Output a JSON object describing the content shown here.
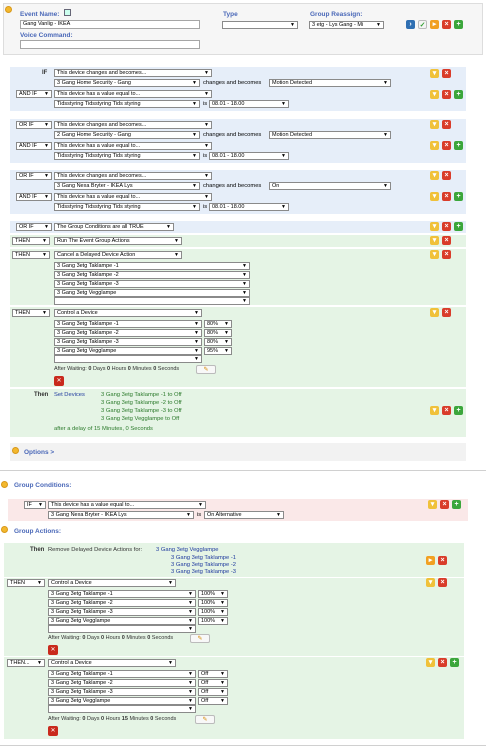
{
  "event": {
    "name_label": "Event Name:",
    "name_value": "Gang Vanlig - IKEA",
    "voice_label": "Voice Command:",
    "voice_value": "",
    "type_label": "Type",
    "type_value": "",
    "reassign_label": "Group Reassign:",
    "reassign_value": "3 etg - Lys Gang - Mi"
  },
  "conditions": {
    "b1": {
      "if_kw": "IF",
      "c1": "This device changes and becomes...",
      "c1_dev": "3 Gang Home Security - Gang",
      "c1_mid": "changes and becomes",
      "c1_state": "Motion Detected",
      "and_kw": "AND IF",
      "c2": "This device has a value equal to...",
      "c2_dev": "Tidsstyring Tidsstyring Tids styring",
      "is": "is",
      "c2_val": "08.01 - 18.00"
    },
    "b2": {
      "or_kw": "OR IF",
      "c1": "This device changes and becomes...",
      "c1_dev": "2 Gang Home Security - Gang",
      "c1_mid": "changes and becomes",
      "c1_state": "Motion Detected",
      "and_kw": "AND IF",
      "c2": "This device has a value equal to...",
      "c2_dev": "Tidsstyring Tidsstyring Tids styring",
      "is": "is",
      "c2_val": "08.01 - 18.00"
    },
    "b3": {
      "or_kw": "OR IF",
      "c1": "This device changes and becomes...",
      "c1_dev": "3 Gang Nexa Bryter - IKEA Lys",
      "c1_mid": "changes and becomes",
      "c1_state": "On",
      "and_kw": "AND IF",
      "c2": "This device has a value equal to...",
      "c2_dev": "Tidsstyring Tidsstyring Tids styring",
      "is": "is",
      "c2_val": "08.01 - 18.00"
    },
    "b4": {
      "or_kw": "OR IF",
      "c1": "The Group Conditions are all TRUE"
    }
  },
  "actions": {
    "a1": {
      "kw": "THEN",
      "value": "Run The Event Group Actions"
    },
    "a2": {
      "kw": "THEN",
      "value": "Cancel a Delayed Device Action",
      "devices": [
        "3 Gang 3etg Taklampe -1",
        "3 Gang 3etg Taklampe -2",
        "3 Gang 3etg Taklampe -3",
        "3 Gang 3etg Vegglampe",
        ""
      ]
    },
    "a3": {
      "kw": "THEN",
      "value": "Control a Device",
      "devices": [
        "3 Gang 3etg Taklampe -1",
        "3 Gang 3etg Taklampe -2",
        "3 Gang 3etg Taklampe -3",
        "3 Gang 3etg Vegglampe",
        ""
      ],
      "levels": [
        "80%",
        "80%",
        "80%",
        "95%"
      ],
      "wait_prefix": "After Waiting:",
      "days": "0",
      "days_label": "Days",
      "hours": "0",
      "hours_label": "Hours",
      "minutes": "0",
      "minutes_label": "Minutes",
      "seconds": "0",
      "seconds_label": "Seconds"
    },
    "summary": {
      "then": "Then",
      "set": "Set Devices",
      "lines": [
        "3 Gang 3etg Taklampe -1 to Off",
        "3 Gang 3etg Taklampe -2 to Off",
        "3 Gang 3etg Taklampe -3 to Off",
        "3 Gang 3etg Vegglampe to Off"
      ],
      "delay": "after a delay of 15 Minutes, 0 Seconds"
    }
  },
  "options_label": "Options >",
  "group_conditions": {
    "title": "Group Conditions:",
    "kw": "IF",
    "c1": "This device has a value equal to...",
    "dev": "3 Gang Nexa Bryter - IKEA Lys",
    "is": "is",
    "val": "On Alternative"
  },
  "group_actions": {
    "title": "Group Actions:",
    "then": "Then",
    "remove_text": "Remove Delayed Device Actions for:",
    "remove_list": [
      "3 Gang 3etg Vegglampe",
      "3 Gang 3etg Taklampe -1",
      "3 Gang 3etg Taklampe -2",
      "3 Gang 3etg Taklampe -3"
    ],
    "g1": {
      "kw": "THEN",
      "value": "Control a Device",
      "devices": [
        "3 Gang 3etg Taklampe -1",
        "3 Gang 3etg Taklampe -2",
        "3 Gang 3etg Taklampe -3",
        "3 Gang 3etg Vegglampe",
        ""
      ],
      "levels": [
        "100%",
        "100%",
        "100%",
        "100%"
      ],
      "wait_prefix": "After Waiting:",
      "days": "0",
      "days_label": "Days",
      "hours": "0",
      "hours_label": "Hours",
      "minutes": "0",
      "minutes_label": "Minutes",
      "seconds": "0",
      "seconds_label": "Seconds"
    },
    "g2": {
      "kw": "THEN...",
      "value": "Control a Device",
      "devices": [
        "3 Gang 3etg Taklampe -1",
        "3 Gang 3etg Taklampe -2",
        "3 Gang 3etg Taklampe -3",
        "3 Gang 3etg Vegglampe",
        ""
      ],
      "levels": [
        "Off",
        "Off",
        "Off",
        "Off"
      ],
      "wait_prefix": "After Waiting:",
      "days": "0",
      "days_label": "Days",
      "hours": "0",
      "hours_label": "Hours",
      "minutes": "15",
      "minutes_label": "Minutes",
      "seconds": "0",
      "seconds_label": "Seconds"
    }
  },
  "icons": {
    "dropdown": "chevron-down-icon",
    "up": "arrow-up-icon",
    "delete": "x-icon",
    "add": "plus-icon",
    "play": "play-icon",
    "go": "go-icon",
    "check": "check-icon",
    "edit": "pencil-icon",
    "calendar": "calendar-icon",
    "expand": "expand-circle-icon"
  },
  "colors": {
    "label_blue": "#4a68b8",
    "blue_band": "#e6eef9",
    "green_band": "#e5f4e5",
    "pink_band": "#fae8e8",
    "add_green": "#3ba63b",
    "delete_red": "#d93c2a",
    "move_yellow": "#f0c13a"
  }
}
